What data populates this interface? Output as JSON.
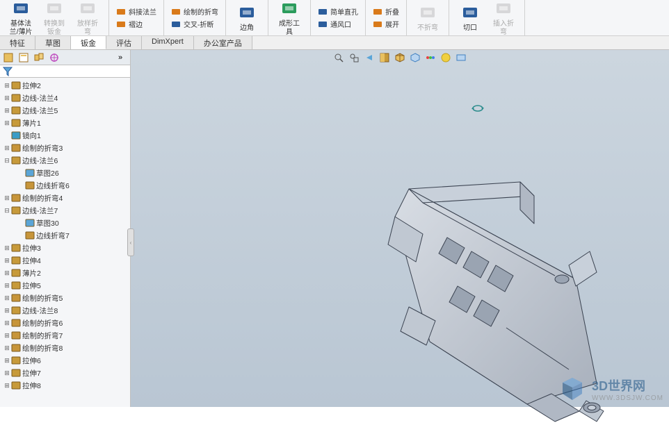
{
  "ribbon": {
    "groups": [
      {
        "kind": "big",
        "items": [
          {
            "label": "基体法\n兰/薄片",
            "color": "#2b5d9c",
            "name": "base-flange-button"
          },
          {
            "label": "转换到\n钣金",
            "color": "#aaa",
            "disabled": true,
            "name": "convert-to-sheetmetal-button"
          },
          {
            "label": "放样折\n弯",
            "color": "#aaa",
            "disabled": true,
            "name": "lofted-bend-button"
          }
        ]
      },
      {
        "kind": "small",
        "items": [
          {
            "label": "斜接法兰",
            "color": "#d97a1a",
            "name": "miter-flange-button"
          },
          {
            "label": "褶边",
            "color": "#d97a1a",
            "name": "hem-button"
          }
        ]
      },
      {
        "kind": "small",
        "items": [
          {
            "label": "绘制的折弯",
            "color": "#d97a1a",
            "name": "sketched-bend-button"
          },
          {
            "label": "交叉-折断",
            "color": "#2b5d9c",
            "name": "cross-break-button"
          }
        ]
      },
      {
        "kind": "big",
        "items": [
          {
            "label": "边角",
            "color": "#2b5d9c",
            "name": "corner-button"
          }
        ]
      },
      {
        "kind": "big",
        "items": [
          {
            "label": "成形工\n具",
            "color": "#2b9c5d",
            "name": "forming-tool-button"
          }
        ]
      },
      {
        "kind": "small",
        "items": [
          {
            "label": "简单直孔",
            "color": "#2b5d9c",
            "name": "simple-hole-button"
          },
          {
            "label": "通风口",
            "color": "#2b5d9c",
            "name": "vent-button"
          }
        ]
      },
      {
        "kind": "small",
        "items": [
          {
            "label": "折叠",
            "color": "#d97a1a",
            "name": "fold-button"
          },
          {
            "label": "展开",
            "color": "#d97a1a",
            "name": "unfold-button"
          }
        ]
      },
      {
        "kind": "big",
        "items": [
          {
            "label": "不折弯",
            "color": "#aaa",
            "disabled": true,
            "name": "no-bend-button"
          }
        ]
      },
      {
        "kind": "big",
        "items": [
          {
            "label": "切口",
            "color": "#2b5d9c",
            "name": "rip-button"
          },
          {
            "label": "插入折\n弯",
            "color": "#aaa",
            "disabled": true,
            "name": "insert-bends-button"
          }
        ]
      }
    ]
  },
  "tabs": [
    {
      "label": "特征",
      "active": false,
      "name": "tab-features"
    },
    {
      "label": "草图",
      "active": false,
      "name": "tab-sketch"
    },
    {
      "label": "钣金",
      "active": true,
      "name": "tab-sheetmetal"
    },
    {
      "label": "评估",
      "active": false,
      "name": "tab-evaluate"
    },
    {
      "label": "DimXpert",
      "active": false,
      "name": "tab-dimxpert"
    },
    {
      "label": "办公室产品",
      "active": false,
      "name": "tab-office"
    }
  ],
  "tree": [
    {
      "indent": 0,
      "exp": "+",
      "icon": "#c79a3a",
      "label": "拉伸2"
    },
    {
      "indent": 0,
      "exp": "+",
      "icon": "#c79a3a",
      "label": "边线-法兰4"
    },
    {
      "indent": 0,
      "exp": "+",
      "icon": "#c79a3a",
      "label": "边线-法兰5"
    },
    {
      "indent": 0,
      "exp": "+",
      "icon": "#c79a3a",
      "label": "薄片1"
    },
    {
      "indent": 0,
      "exp": "",
      "icon": "#3a9cc7",
      "label": "镜向1"
    },
    {
      "indent": 0,
      "exp": "+",
      "icon": "#c7953a",
      "label": "绘制的折弯3"
    },
    {
      "indent": 0,
      "exp": "-",
      "icon": "#c79a3a",
      "label": "边线-法兰6"
    },
    {
      "indent": 1,
      "exp": "",
      "icon": "#5aa5d8",
      "label": "草图26"
    },
    {
      "indent": 1,
      "exp": "",
      "icon": "#c7953a",
      "label": "边线折弯6"
    },
    {
      "indent": 0,
      "exp": "+",
      "icon": "#c7953a",
      "label": "绘制的折弯4"
    },
    {
      "indent": 0,
      "exp": "-",
      "icon": "#c79a3a",
      "label": "边线-法兰7"
    },
    {
      "indent": 1,
      "exp": "",
      "icon": "#5aa5d8",
      "label": "草图30"
    },
    {
      "indent": 1,
      "exp": "",
      "icon": "#c7953a",
      "label": "边线折弯7"
    },
    {
      "indent": 0,
      "exp": "+",
      "icon": "#c79a3a",
      "label": "拉伸3"
    },
    {
      "indent": 0,
      "exp": "+",
      "icon": "#c79a3a",
      "label": "拉伸4"
    },
    {
      "indent": 0,
      "exp": "+",
      "icon": "#c79a3a",
      "label": "薄片2"
    },
    {
      "indent": 0,
      "exp": "+",
      "icon": "#c79a3a",
      "label": "拉伸5"
    },
    {
      "indent": 0,
      "exp": "+",
      "icon": "#c7953a",
      "label": "绘制的折弯5"
    },
    {
      "indent": 0,
      "exp": "+",
      "icon": "#c79a3a",
      "label": "边线-法兰8"
    },
    {
      "indent": 0,
      "exp": "+",
      "icon": "#c7953a",
      "label": "绘制的折弯6"
    },
    {
      "indent": 0,
      "exp": "+",
      "icon": "#c7953a",
      "label": "绘制的折弯7"
    },
    {
      "indent": 0,
      "exp": "+",
      "icon": "#c7953a",
      "label": "绘制的折弯8"
    },
    {
      "indent": 0,
      "exp": "+",
      "icon": "#c79a3a",
      "label": "拉伸6"
    },
    {
      "indent": 0,
      "exp": "+",
      "icon": "#c79a3a",
      "label": "拉伸7"
    },
    {
      "indent": 0,
      "exp": "+",
      "icon": "#c79a3a",
      "label": "拉伸8"
    }
  ],
  "watermark": {
    "title": "3D世界网",
    "sub": "WWW.3DSJW.COM"
  },
  "colors": {
    "orange": "#d97a1a",
    "blue": "#2b5d9c",
    "green": "#2b9c5d",
    "gray": "#aaa"
  }
}
